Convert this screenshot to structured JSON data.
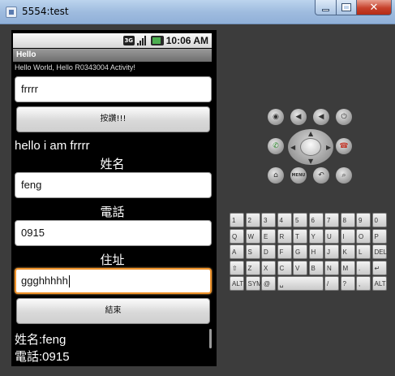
{
  "window": {
    "title": "5554:test",
    "min_glyph": "",
    "close_glyph": "✕"
  },
  "status_bar": {
    "icon_3g": "3G",
    "time": "10:06 AM"
  },
  "app": {
    "title": "Hello",
    "hello_text": "Hello World, Hello R0343004 Activity!",
    "input1_value": "frrrr",
    "button1_label": "按讚!!!",
    "greeting": "hello i am frrrr",
    "name_label": "姓名",
    "name_value": "feng",
    "phone_label": "電話",
    "phone_value": "0915",
    "address_label": "住址",
    "address_value": "ggghhhhh",
    "end_button_label": "結束",
    "result_name": "姓名:feng",
    "result_phone": "電話:0915"
  },
  "controls": {
    "menu_label": "MENU"
  },
  "keyboard": {
    "rows": [
      [
        "1",
        "2",
        "3",
        "4",
        "5",
        "6",
        "7",
        "8",
        "9",
        "0"
      ],
      [
        "Q",
        "W",
        "E",
        "R",
        "T",
        "Y",
        "U",
        "I",
        "O",
        "P"
      ],
      [
        "A",
        "S",
        "D",
        "F",
        "G",
        "H",
        "J",
        "K",
        "L",
        "DEL"
      ],
      [
        "⇧",
        "Z",
        "X",
        "C",
        "V",
        "B",
        "N",
        "M",
        ".",
        "↵"
      ],
      [
        "ALT",
        "SYM",
        "@",
        "␣",
        "/",
        "?",
        ",",
        "ALT"
      ]
    ]
  }
}
